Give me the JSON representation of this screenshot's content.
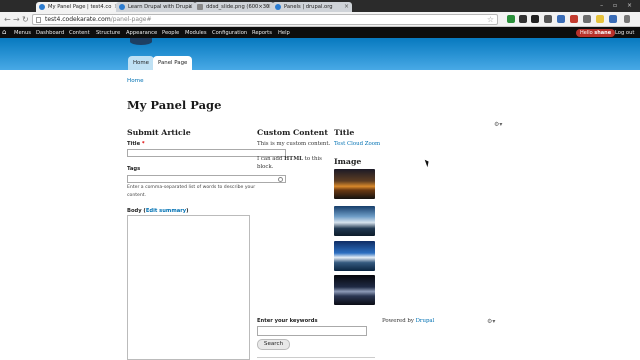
{
  "browser": {
    "tabs": [
      {
        "title": "My Panel Page | test4.co",
        "active": true,
        "favicon": "drupal-icon"
      },
      {
        "title": "Learn Drupal with Drupa",
        "active": false,
        "favicon": "drupal-icon"
      },
      {
        "title": "ddsd_slide.png (600×30",
        "active": false,
        "favicon": "image-icon"
      },
      {
        "title": "Panels | drupal.org",
        "active": false,
        "favicon": "drupal-icon"
      }
    ],
    "url_host": "test4.codekarate.com",
    "url_path": "/panel-page#"
  },
  "admin_bar": {
    "items": [
      "Menus",
      "Dashboard",
      "Content",
      "Structure",
      "Appearance",
      "People",
      "Modules",
      "Configuration",
      "Reports",
      "Help"
    ],
    "hello_prefix": "Hello ",
    "username": "shane",
    "logout": "Log out"
  },
  "page_tabs": [
    "Home",
    "Panel Page"
  ],
  "breadcrumb": "Home",
  "page_title": "My Panel Page",
  "submit_article": {
    "heading": "Submit Article",
    "title_label": "Title",
    "required_mark": "*",
    "tags_label": "Tags",
    "tags_description": "Enter a comma-separated list of words to describe your content.",
    "body_label": "Body",
    "edit_summary": "Edit summary"
  },
  "custom_content": {
    "heading": "Custom Content",
    "line1": "This is my custom content.",
    "line2_pre": "I can add ",
    "line2_bold": "HTML",
    "line2_post": " to this",
    "line3": "block."
  },
  "title_block": {
    "heading": "Title",
    "link": "Test Cloud Zoom"
  },
  "image_block": {
    "heading": "Image"
  },
  "search_block": {
    "label": "Enter your keywords",
    "button": "Search"
  },
  "footer": {
    "powered_by": "Powered by ",
    "drupal_link": "Drupal"
  },
  "colors": {
    "header_top": "#0779bf",
    "link": "#0071b3",
    "admin_bar": "#0d0d0d",
    "hello_badge": "#b7312b"
  }
}
